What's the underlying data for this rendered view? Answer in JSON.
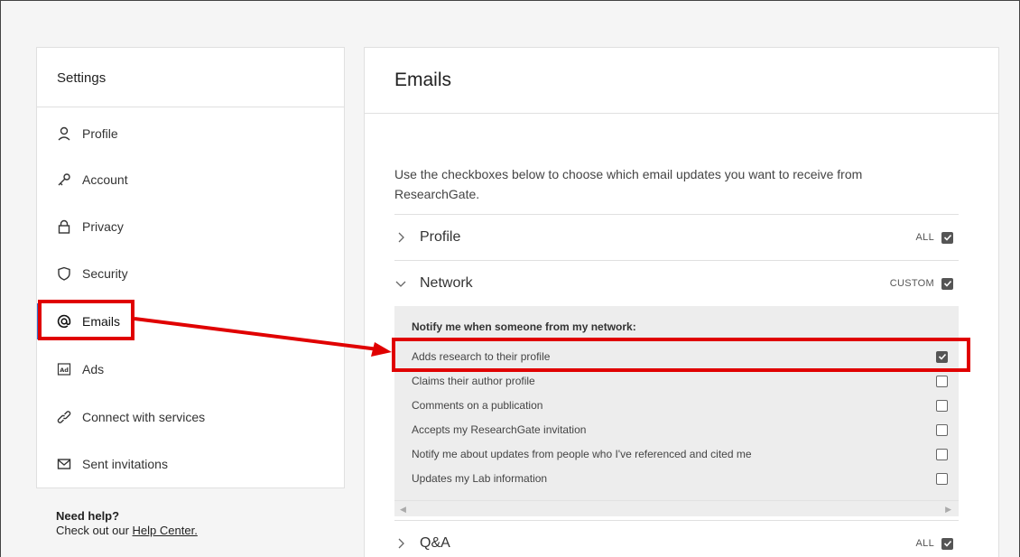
{
  "sidebar": {
    "title": "Settings",
    "items": [
      {
        "label": "Profile",
        "icon": "person-icon"
      },
      {
        "label": "Account",
        "icon": "key-icon"
      },
      {
        "label": "Privacy",
        "icon": "lock-icon"
      },
      {
        "label": "Security",
        "icon": "shield-icon"
      },
      {
        "label": "Emails",
        "icon": "at-icon"
      },
      {
        "label": "Ads",
        "icon": "ad-icon"
      },
      {
        "label": "Connect with services",
        "icon": "link-icon"
      },
      {
        "label": "Sent invitations",
        "icon": "envelope-icon"
      }
    ],
    "active_item": "Emails"
  },
  "help": {
    "title": "Need help?",
    "text": "Check out our ",
    "link": "Help Center."
  },
  "main": {
    "title": "Emails",
    "intro": "Use the checkboxes below to choose which email updates you want to receive from ResearchGate.",
    "sections": [
      {
        "label": "Profile",
        "status": "ALL",
        "checked": true,
        "expanded": false
      },
      {
        "label": "Network",
        "status": "CUSTOM",
        "checked": true,
        "expanded": true
      },
      {
        "label": "Q&A",
        "status": "ALL",
        "checked": true,
        "expanded": false
      }
    ],
    "network": {
      "heading": "Notify me when someone from my network:",
      "options": [
        {
          "label": "Adds research to their profile",
          "checked": true
        },
        {
          "label": "Claims their author profile",
          "checked": false
        },
        {
          "label": "Comments on a publication",
          "checked": false
        },
        {
          "label": "Accepts my ResearchGate invitation",
          "checked": false
        },
        {
          "label": "Notify me about updates from people who I've referenced and cited me",
          "checked": false
        },
        {
          "label": "Updates my Lab information",
          "checked": false
        }
      ]
    }
  },
  "colors": {
    "highlight": "#e00000",
    "active_indicator": "#2f6fd0"
  }
}
